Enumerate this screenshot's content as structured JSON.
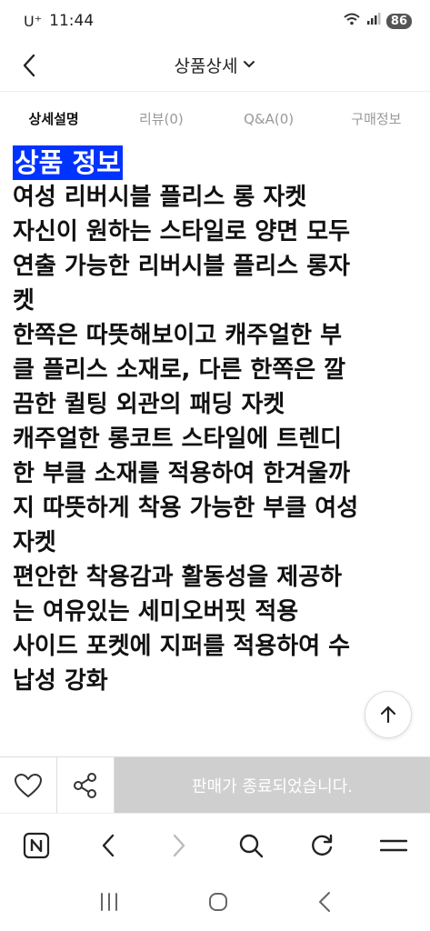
{
  "status_bar": {
    "carrier": "U⁺",
    "time": "11:44",
    "battery": "86"
  },
  "header": {
    "title": "상품상세"
  },
  "tabs": [
    {
      "label": "상세설명",
      "active": true
    },
    {
      "label": "리뷰(0)",
      "active": false
    },
    {
      "label": "Q&A(0)",
      "active": false
    },
    {
      "label": "구매정보",
      "active": false
    }
  ],
  "content": {
    "section_title": "상품 정보",
    "lines": [
      "여성 리버시블 플리스 롱 자켓",
      "자신이 원하는 스타일로 양면 모두",
      "연출 가능한 리버시블 플리스 롱자",
      "켓",
      "한쪽은 따뜻해보이고 캐주얼한 부",
      "클 플리스 소재로, 다른 한쪽은 깔",
      "끔한 퀼팅 외관의 패딩 자켓",
      "캐주얼한 롱코트 스타일에 트렌디",
      "한 부클 소재를 적용하여 한겨울까",
      "지 따뜻하게 착용 가능한 부클 여성",
      "자켓",
      "편안한 착용감과 활동성을 제공하",
      "는 여유있는 세미오버핏 적용",
      "사이드 포켓에 지퍼를 적용하여 수",
      "납성 강화"
    ]
  },
  "action_bar": {
    "sold_out_label": "판매가 종료되었습니다."
  },
  "icons": {
    "accent": "#0033ff",
    "disabled": "#cfcfcf"
  }
}
